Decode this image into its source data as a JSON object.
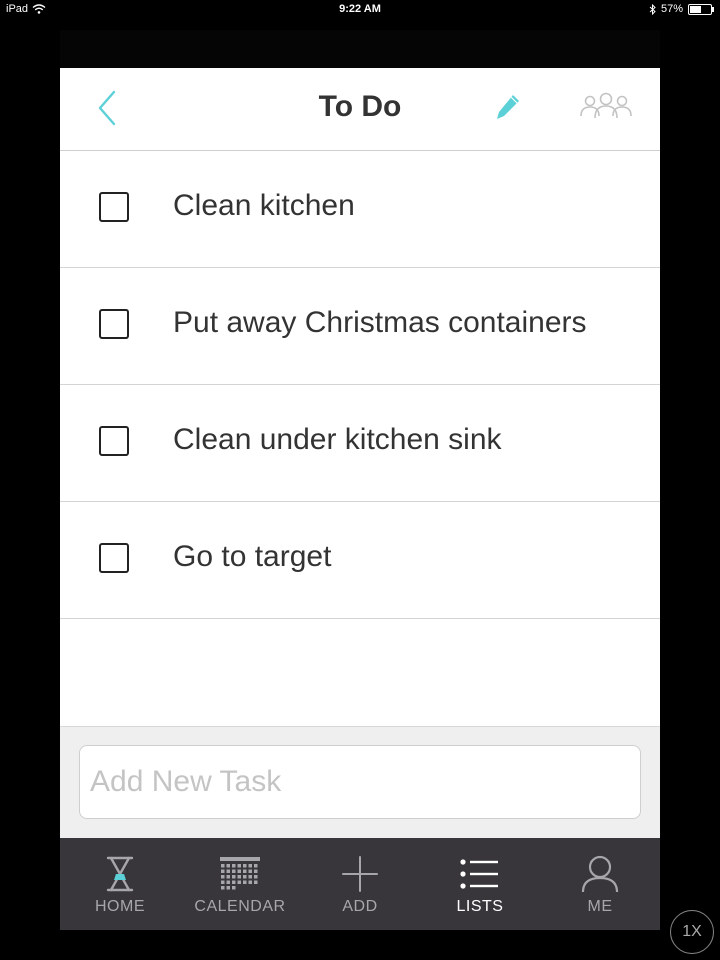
{
  "status_bar": {
    "device": "iPad",
    "time": "9:22 AM",
    "battery_percent": "57%",
    "battery_level": 0.57
  },
  "header": {
    "title": "To Do",
    "back_icon": "chevron-left-icon",
    "edit_icon": "pencil-icon",
    "share_icon": "people-group-icon",
    "accent_color": "#5bd1d7"
  },
  "tasks": [
    {
      "label": "Clean kitchen",
      "checked": false
    },
    {
      "label": "Put away Christmas containers",
      "checked": false
    },
    {
      "label": "Clean under kitchen sink",
      "checked": false
    },
    {
      "label": "Go to target",
      "checked": false
    }
  ],
  "add_task": {
    "placeholder": "Add New Task",
    "value": ""
  },
  "tabbar": {
    "active": "LISTS",
    "tabs": [
      {
        "label": "HOME",
        "icon": "hourglass-icon"
      },
      {
        "label": "CALENDAR",
        "icon": "calendar-icon"
      },
      {
        "label": "ADD",
        "icon": "plus-icon"
      },
      {
        "label": "LISTS",
        "icon": "list-icon"
      },
      {
        "label": "ME",
        "icon": "person-icon"
      }
    ]
  },
  "zoom_badge": "1X"
}
